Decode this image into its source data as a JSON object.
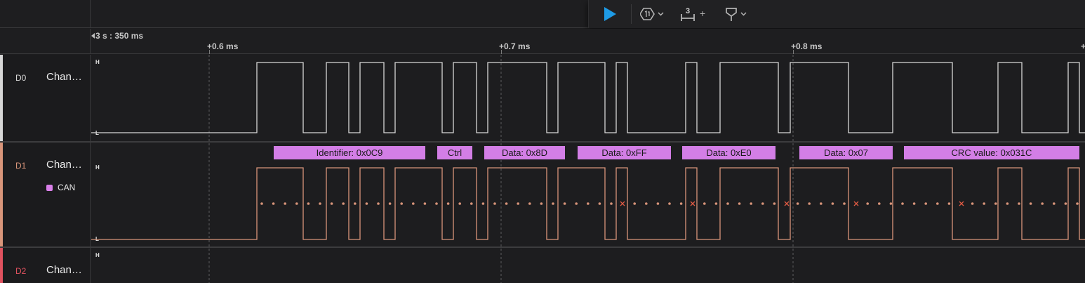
{
  "colors": {
    "accent_play": "#1e9be6",
    "d0": "#d7d7d7",
    "d1": "#d9957a",
    "d2": "#e0525f",
    "can_frame": "#d37ee6",
    "error_marker": "#e05a43",
    "background": "#1d1d1f"
  },
  "toolbar": {
    "play_icon": "play-icon",
    "trigger_icon": "trigger-mode-icon",
    "measure_icon": "measure-icon",
    "measure_count": "3",
    "measure_add": "+",
    "marker_icon": "marker-flag-icon",
    "dropdown_icon": "chevron-down-icon"
  },
  "ruler": {
    "origin": "3 s : 350 ms",
    "ticks": [
      {
        "label": "+0.6 ms",
        "ms": 0.6
      },
      {
        "label": "+0.7 ms",
        "ms": 0.7
      },
      {
        "label": "+0.8 ms",
        "ms": 0.8
      }
    ]
  },
  "channels": [
    {
      "id": "D0",
      "name": "Chan…",
      "high": "H",
      "low": "L",
      "color": "#d7d7d7"
    },
    {
      "id": "D1",
      "name": "Chan…",
      "high": "H",
      "low": "L",
      "color": "#d9957a",
      "analyzer": "CAN"
    },
    {
      "id": "D2",
      "name": "Chan…",
      "high": "H",
      "color": "#e0525f"
    }
  ],
  "can_frames": [
    {
      "label": "Identifier: 0x0C9"
    },
    {
      "label": "Ctrl"
    },
    {
      "label": "Data: 0x8D"
    },
    {
      "label": "Data: 0xFF"
    },
    {
      "label": "Data: 0xE0"
    },
    {
      "label": "Data: 0x07"
    },
    {
      "label": "CRC value: 0x031C"
    }
  ]
}
